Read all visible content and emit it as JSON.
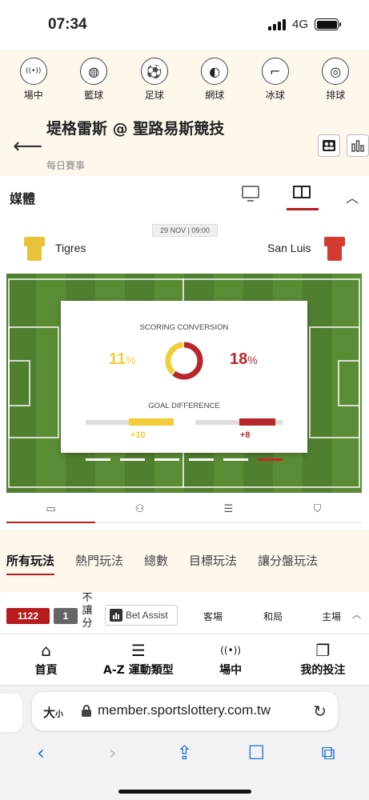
{
  "status": {
    "time": "07:34",
    "network": "4G"
  },
  "sports": [
    {
      "label": "場中",
      "icon": "live-broadcast-icon",
      "glyph": "((•))"
    },
    {
      "label": "籃球",
      "icon": "basketball-icon",
      "glyph": "◍"
    },
    {
      "label": "足球",
      "icon": "soccer-ball-icon",
      "glyph": "⚽"
    },
    {
      "label": "網球",
      "icon": "tennis-ball-icon",
      "glyph": "◐"
    },
    {
      "label": "冰球",
      "icon": "hockey-stick-icon",
      "glyph": "⌐"
    },
    {
      "label": "排球",
      "icon": "volleyball-icon",
      "glyph": "◎"
    }
  ],
  "header": {
    "title": "堤格雷斯 @ 聖路易斯競技",
    "subtitle": "每日賽事"
  },
  "media": {
    "label": "媒體"
  },
  "match": {
    "date": "29 NOV | 09:00",
    "home_team": "Tigres",
    "away_team": "San Luis",
    "home_color": "#e8c23a",
    "away_color": "#d43a2f"
  },
  "stats": {
    "scoring_title": "SCORING CONVERSION",
    "home_pct": "11",
    "away_pct": "18",
    "pct_sign": "%",
    "home_share": 0.38,
    "away_share": 0.62,
    "goal_title": "GOAL DIFFERENCE",
    "home_gd": "+10",
    "away_gd": "+8",
    "home_color": "#f2cd3a",
    "away_color": "#b8282b"
  },
  "pager": {
    "count": 6,
    "active": 5
  },
  "detail_tabs": [
    {
      "name": "tab-pitch",
      "icon": "pitch-icon",
      "glyph": "▭",
      "active": true
    },
    {
      "name": "tab-lineup",
      "icon": "players-icon",
      "glyph": "⚇",
      "active": false
    },
    {
      "name": "tab-stats",
      "icon": "list-icon",
      "glyph": "☰",
      "active": false
    },
    {
      "name": "tab-kit",
      "icon": "shirt-icon",
      "glyph": "⛉",
      "active": false
    }
  ],
  "play_tabs": [
    "所有玩法",
    "熱門玩法",
    "總數",
    "目標玩法",
    "讓分盤玩法"
  ],
  "odds": {
    "badge_total": "1122",
    "badge_count": "1",
    "vertical_text": "不讓分",
    "bet_assist": "Bet Assist",
    "col_away": "客場",
    "col_draw": "和局",
    "col_home": "主場"
  },
  "bottom_nav": [
    {
      "label": "首頁",
      "icon": "home-icon",
      "glyph": "⌂"
    },
    {
      "label": "A-Z 運動類型",
      "icon": "menu-icon",
      "glyph": "☰"
    },
    {
      "label": "場中",
      "icon": "live-broadcast-icon",
      "glyph": "((•))"
    },
    {
      "label": "我的投注",
      "icon": "bet-slip-icon",
      "glyph": "❐"
    }
  ],
  "browser": {
    "text_size": "大",
    "text_size_small": "小",
    "url": "member.sportslottery.com.tw"
  }
}
